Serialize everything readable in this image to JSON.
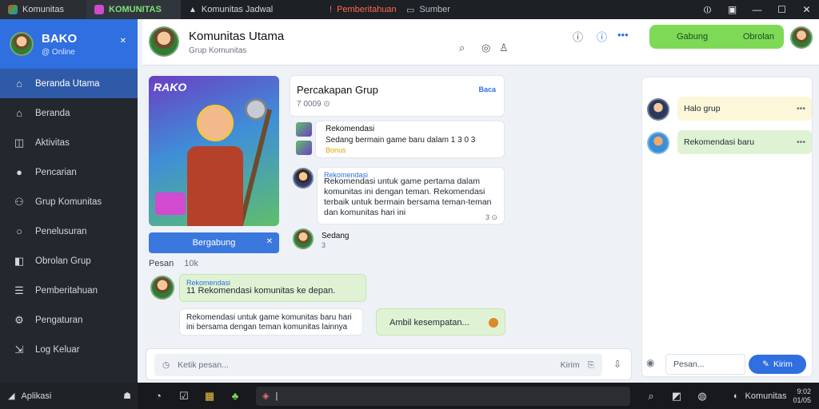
{
  "titlebar": {
    "tabs": [
      {
        "label": "Komunitas",
        "icon": "app-logo-icon"
      },
      {
        "label": "KOMUNITAS",
        "icon": "game-icon"
      },
      {
        "label": "Komunitas Jadwal",
        "icon": "page-icon"
      },
      {
        "label": "Pemberitahuan",
        "icon": "alert-icon"
      },
      {
        "label": "Sumber",
        "icon": "chat-icon"
      }
    ],
    "controls": [
      "pin",
      "restore-split",
      "minimize",
      "maximize",
      "close"
    ]
  },
  "sidebar": {
    "user_name": "BAKO",
    "user_status": "@ Online",
    "items": [
      {
        "label": "Beranda Utama",
        "icon": "home-icon",
        "active": true
      },
      {
        "label": "Beranda",
        "icon": "house-icon"
      },
      {
        "label": "Aktivitas",
        "icon": "activity-icon"
      },
      {
        "label": "Pencarian",
        "icon": "globe-icon"
      },
      {
        "label": "Grup Komunitas",
        "icon": "group-icon"
      },
      {
        "label": "Penelusuran",
        "icon": "search-icon"
      },
      {
        "label": "Obrolan Grup",
        "icon": "chat-icon"
      },
      {
        "label": "Pemberitahuan",
        "icon": "list-icon"
      },
      {
        "label": "Pengaturan",
        "icon": "settings-icon"
      },
      {
        "label": "Log Keluar",
        "icon": "logout-icon"
      }
    ]
  },
  "header": {
    "title": "Komunitas Utama",
    "subtitle": "Grup Komunitas",
    "action_button": {
      "label": "Gabung",
      "secondary": "Obrolan"
    }
  },
  "featured": {
    "image_caption": "RAKO",
    "button_label": "Bergabung",
    "section_label": "Pesan",
    "section_count": "10k"
  },
  "info_card": {
    "title": "Percakapan Grup",
    "meta": "7 0009 ⊙",
    "action": "Baca"
  },
  "game_card": {
    "heading": "Rekomendasi",
    "body": "Sedang bermain game baru dalam 1 3 0 3",
    "highlight": "Bonus"
  },
  "long_message": {
    "heading": "Rekomendasi",
    "body": "Rekomendasi untuk game pertama dalam komunitas ini dengan teman. Rekomendasi terbaik untuk bermain bersama teman-teman dan komunitas hari ini",
    "meta": "3 ⊙"
  },
  "sender": {
    "name": "Sedang",
    "sub": "3"
  },
  "messages": [
    {
      "heading": "Rekomendasi",
      "text": "11 Rekomendasi komunitas ke depan."
    },
    {
      "text": "Rekomendasi untuk game komunitas baru hari ini bersama dengan teman komunitas lainnya"
    },
    {
      "text": "Ambil kesempatan..."
    }
  ],
  "composer": {
    "placeholder": "Ketik pesan...",
    "right_label": "Kirim"
  },
  "right_panel": {
    "rows": [
      {
        "text": "Halo grup",
        "tone": "yellow"
      },
      {
        "text": "Rekomendasi baru",
        "tone": "green"
      }
    ],
    "compose_placeholder": "Pesan...",
    "send_label": "Kirim"
  },
  "taskbar": {
    "start_label": "Aplikasi",
    "search_label": "|",
    "tray_label": "Komunitas",
    "clock_time": "9:02",
    "clock_date": "01/05"
  },
  "colors": {
    "accent": "#2f6fe0",
    "green": "#7ed957",
    "sidebar": "#23272e",
    "titlebar": "#1d2024"
  }
}
